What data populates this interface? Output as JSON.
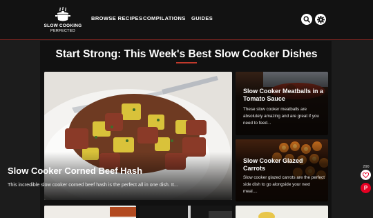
{
  "header": {
    "logo_line1": "SLOW COOKING",
    "logo_line2": "PERFECTED",
    "nav": [
      "BROWSE RECIPES",
      "COMPILATIONS",
      "GUIDES"
    ],
    "icons": [
      "search-icon",
      "gear-icon"
    ]
  },
  "main": {
    "title": "Start Strong: This Week's Best Slow Cooker Dishes",
    "accent_color": "#c0392b",
    "featured": {
      "title": "Slow Cooker Corned Beef Hash",
      "description": "This incredible slow cooker corned beef hash is the perfect all in one dish. It..."
    },
    "side_cards": [
      {
        "title": "Slow Cooker Meatballs in a Tomato Sauce",
        "description": "These slow cooker meatballs are absolutely amazing and are great if you need to feed..."
      },
      {
        "title": "Slow Cooker Glazed Carrots",
        "description": "Slow cooker glazed carrots are the perfect side dish to go alongside your next meal...."
      }
    ]
  },
  "floating": {
    "favorite_count": "290",
    "pin_label": "P"
  }
}
